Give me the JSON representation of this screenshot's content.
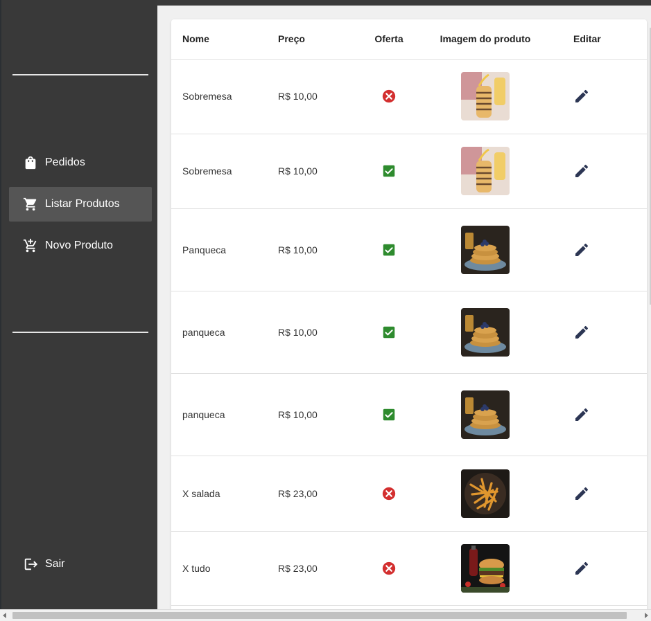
{
  "sidebar": {
    "items": [
      {
        "label": "Pedidos",
        "icon": "shopping-bag-icon",
        "active": false
      },
      {
        "label": "Listar Produtos",
        "icon": "shopping-cart-icon",
        "active": true
      },
      {
        "label": "Novo Produto",
        "icon": "add-shopping-cart-icon",
        "active": false
      }
    ],
    "logout": {
      "label": "Sair",
      "icon": "logout-icon"
    }
  },
  "table": {
    "headers": {
      "name": "Nome",
      "price": "Preço",
      "offer": "Oferta",
      "image": "Imagem do produto",
      "edit": "Editar"
    },
    "rows": [
      {
        "name": "Sobremesa",
        "price": "R$ 10,00",
        "offer": false,
        "image": "drizzled-dessert-stack"
      },
      {
        "name": "Sobremesa",
        "price": "R$ 10,00",
        "offer": true,
        "image": "drizzled-dessert-stack"
      },
      {
        "name": "Panqueca",
        "price": "R$ 10,00",
        "offer": true,
        "image": "pancake-stack-blueberries"
      },
      {
        "name": "panqueca",
        "price": "R$ 10,00",
        "offer": true,
        "image": "pancake-stack-blueberries"
      },
      {
        "name": "panqueca",
        "price": "R$ 10,00",
        "offer": true,
        "image": "pancake-stack-blueberries"
      },
      {
        "name": "X salada",
        "price": "R$ 23,00",
        "offer": false,
        "image": "french-fries"
      },
      {
        "name": "X tudo",
        "price": "R$ 23,00",
        "offer": false,
        "image": "burger-and-soda"
      }
    ]
  },
  "colors": {
    "sidebar_bg": "#393939",
    "active_item_bg": "#555555",
    "offer_true": "#2e8b2e",
    "offer_false": "#d32f2f",
    "edit_icon": "#2c3654"
  }
}
